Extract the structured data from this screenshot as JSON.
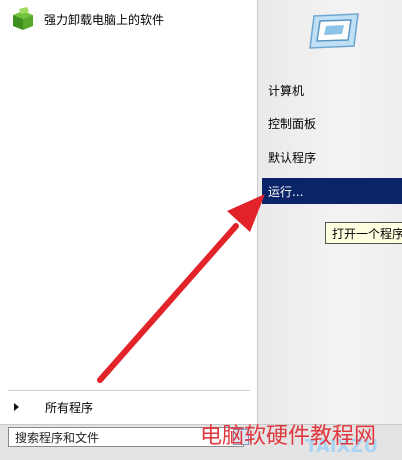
{
  "left_pane": {
    "pinned_program": {
      "label": "强力卸载电脑上的软件",
      "icon": "green-box-icon"
    },
    "all_programs_label": "所有程序",
    "search_placeholder": "搜索程序和文件"
  },
  "right_pane": {
    "items": [
      {
        "label": "计算机"
      },
      {
        "label": "控制面板"
      },
      {
        "label": "默认程序"
      },
      {
        "label": "运行..."
      }
    ],
    "selected_index": 3,
    "tooltip": "打开一个程序"
  },
  "watermark": {
    "text": "电脑软硬件教程网",
    "sub_text": "TAIXZU"
  },
  "colors": {
    "selection_bg": "#0a246a",
    "arrow": "#e2232a",
    "tooltip_bg": "#ffffe1"
  }
}
